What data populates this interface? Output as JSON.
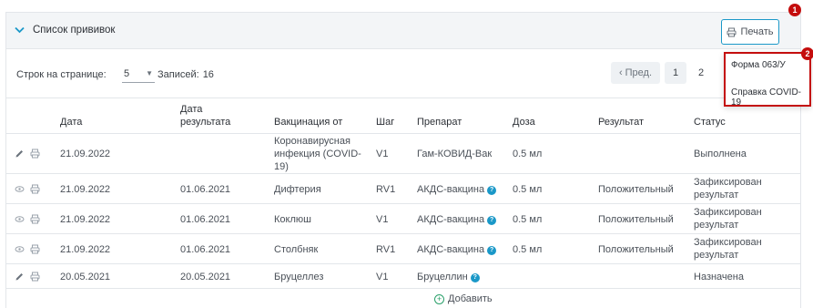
{
  "panel": {
    "title": "Список прививок",
    "print_label": "Печать",
    "badge_print": "1",
    "badge_menu": "2"
  },
  "pager": {
    "rows_label": "Строк на странице:",
    "rows_value": "5",
    "records_label": "Записей:",
    "records_count": "16",
    "prev_label": "Пред.",
    "pages": [
      "1",
      "2"
    ]
  },
  "table": {
    "headers": {
      "date": "Дата",
      "result_date_1": "Дата",
      "result_date_2": "результата",
      "vaccination_from": "Вакцинация от",
      "step": "Шаг",
      "drug": "Препарат",
      "dose": "Доза",
      "result": "Результат",
      "status": "Статус"
    },
    "rows": [
      {
        "icon1": "pencil-icon",
        "date": "21.09.2022",
        "result_date": "",
        "vacc_1": "Коронавирусная",
        "vacc_2": "инфекция (COVID-",
        "vacc_3": "19)",
        "step": "V1",
        "drug": "Гам-КОВИД-Вак",
        "help": false,
        "dose": "0.5 мл",
        "result": "",
        "status_1": "Выполнена",
        "status_2": ""
      },
      {
        "icon1": "eye-icon",
        "date": "21.09.2022",
        "result_date": "01.06.2021",
        "vacc_1": "Дифтерия",
        "vacc_2": "",
        "vacc_3": "",
        "step": "RV1",
        "drug": "АКДС-вакцина",
        "help": true,
        "dose": "0.5 мл",
        "result": "Положительный",
        "status_1": "Зафиксирован",
        "status_2": "результат"
      },
      {
        "icon1": "eye-icon",
        "date": "21.09.2022",
        "result_date": "01.06.2021",
        "vacc_1": "Коклюш",
        "vacc_2": "",
        "vacc_3": "",
        "step": "V1",
        "drug": "АКДС-вакцина",
        "help": true,
        "dose": "0.5 мл",
        "result": "Положительный",
        "status_1": "Зафиксирован",
        "status_2": "результат"
      },
      {
        "icon1": "eye-icon",
        "date": "21.09.2022",
        "result_date": "01.06.2021",
        "vacc_1": "Столбняк",
        "vacc_2": "",
        "vacc_3": "",
        "step": "RV1",
        "drug": "АКДС-вакцина",
        "help": true,
        "dose": "0.5 мл",
        "result": "Положительный",
        "status_1": "Зафиксирован",
        "status_2": "результат"
      },
      {
        "icon1": "pencil-icon",
        "date": "20.05.2021",
        "result_date": "20.05.2021",
        "vacc_1": "Бруцеллез",
        "vacc_2": "",
        "vacc_3": "",
        "step": "V1",
        "drug": "Бруцеллин",
        "help": true,
        "dose": "",
        "result": "",
        "status_1": "Назначена",
        "status_2": ""
      }
    ],
    "add_label": "Добавить"
  },
  "print_menu": {
    "items": [
      "Форма 063/У",
      "Справка COVID-19"
    ]
  },
  "colors": {
    "accent": "#1a98c8",
    "badge": "#c40d0d",
    "add": "#2aa06a"
  }
}
